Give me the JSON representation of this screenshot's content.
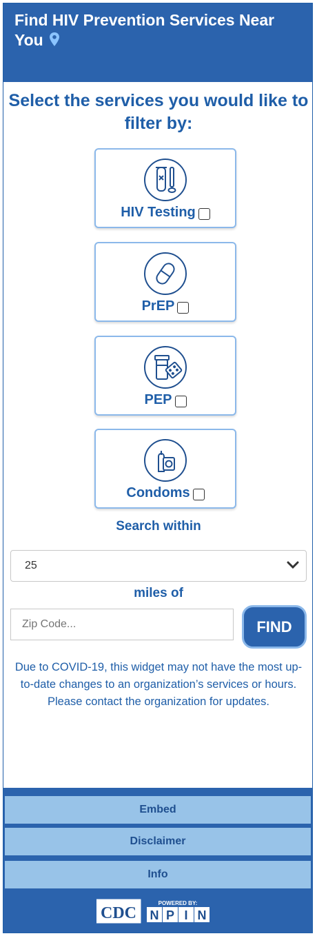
{
  "header": {
    "title": "Find HIV Prevention Services Near You",
    "pin_icon": "map-pin-icon"
  },
  "heading": "Select the services you would like to filter by:",
  "services": [
    {
      "label": "HIV Testing",
      "icon": "test-tube-icon",
      "checked": false
    },
    {
      "label": "PrEP",
      "icon": "pill-icon",
      "checked": false
    },
    {
      "label": "PEP",
      "icon": "pill-bottle-icon",
      "checked": false
    },
    {
      "label": "Condoms",
      "icon": "condom-icon",
      "checked": false
    }
  ],
  "search": {
    "search_within_label": "Search within",
    "miles_value": "25",
    "miles_of_label": "miles of",
    "zip_placeholder": "Zip Code...",
    "find_label": "FIND"
  },
  "notice": "Due to COVID-19, this widget may not have the most up-to-date changes to an organization’s services or hours. Please contact the organization for updates.",
  "footer": {
    "buttons": [
      "Embed",
      "Disclaimer",
      "Info"
    ],
    "logos": {
      "cdc": "CDC",
      "powered_by": "POWERED BY:",
      "npin": "NPIN"
    }
  },
  "colors": {
    "primary": "#2b63ad",
    "accent_light": "#98c3e8",
    "text_blue": "#1f5ea8"
  }
}
